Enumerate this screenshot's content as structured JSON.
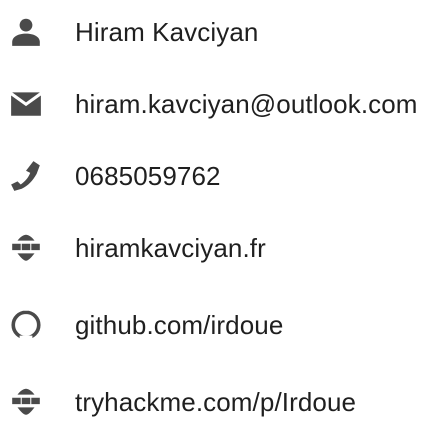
{
  "colors": {
    "icon": "#4a4a4a",
    "text": "#1f1f1f",
    "background": "#ffffff"
  },
  "contacts": [
    {
      "icon": "user-icon",
      "label": "Hiram Kavciyan"
    },
    {
      "icon": "envelope-icon",
      "label": "hiram.kavciyan@outlook.com"
    },
    {
      "icon": "phone-icon",
      "label": "0685059762"
    },
    {
      "icon": "globe-icon",
      "label": "hiramkavciyan.fr"
    },
    {
      "icon": "github-icon",
      "label": "github.com/irdoue"
    },
    {
      "icon": "globe-icon",
      "label": "tryhackme.com/p/Irdoue"
    }
  ]
}
